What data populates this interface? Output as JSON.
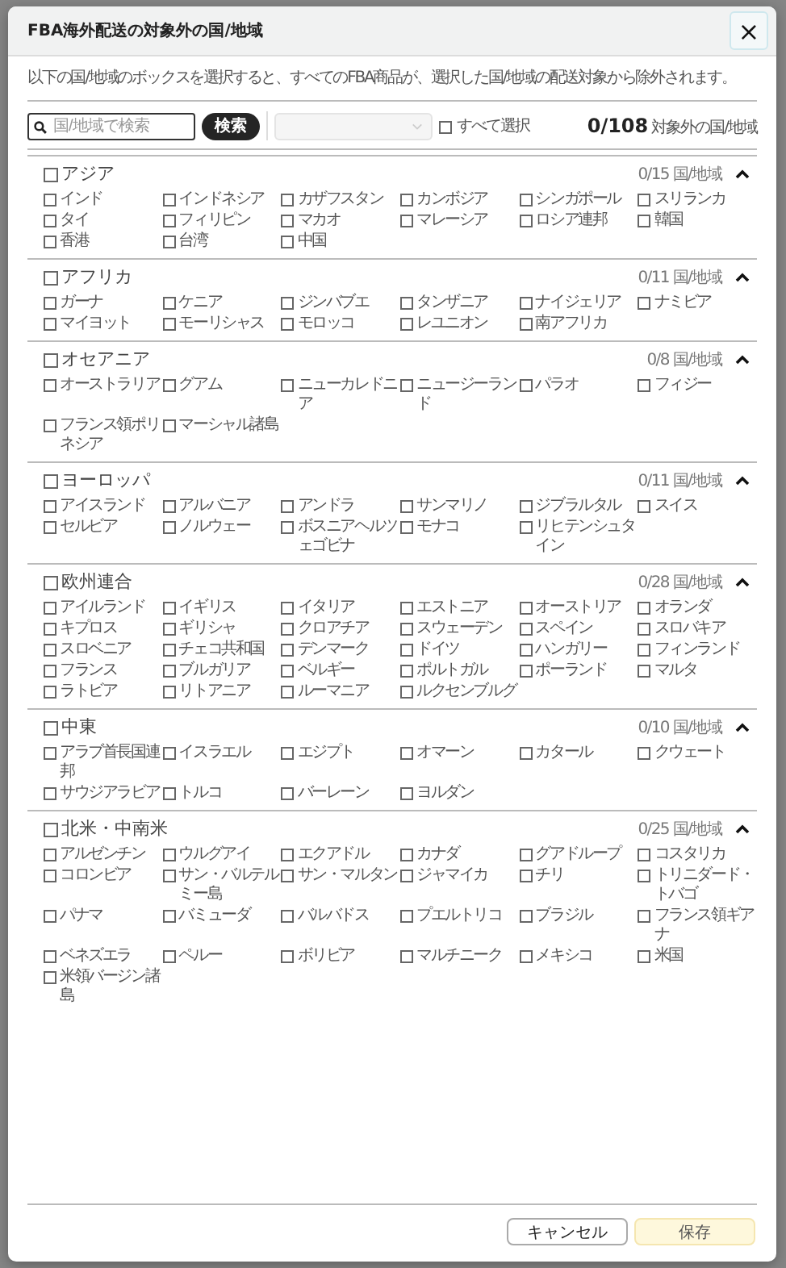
{
  "dialog": {
    "title": "FBA海外配送の対象外の国/地域",
    "close": "×",
    "description": "以下の国/地域のボックスを選択すると、すべてのFBA商品が、選択した国/地域の配送対象から除外されます。"
  },
  "toolbar": {
    "search": {
      "placeholder": "国/地域で検索"
    },
    "search_button": "検索",
    "dropdown": {
      "disabled": true
    },
    "select_all": {
      "label": "すべて選択",
      "checked": false
    },
    "count": "0/108",
    "count_label": "対象外の国/地域"
  },
  "regions": [
    {
      "name": "アジア",
      "checked": false,
      "count": "0/15 国/地域",
      "expanded": true,
      "countries": [
        {
          "name": "インド",
          "checked": false
        },
        {
          "name": "インドネシア",
          "checked": false
        },
        {
          "name": "カザフスタン",
          "checked": false
        },
        {
          "name": "カンボジア",
          "checked": false
        },
        {
          "name": "シンガポール",
          "checked": false
        },
        {
          "name": "スリランカ",
          "checked": false
        },
        {
          "name": "タイ",
          "checked": false
        },
        {
          "name": "フィリピン",
          "checked": false
        },
        {
          "name": "マカオ",
          "checked": false
        },
        {
          "name": "マレーシア",
          "checked": false
        },
        {
          "name": "ロシア連邦",
          "checked": false
        },
        {
          "name": "韓国",
          "checked": false
        },
        {
          "name": "香港",
          "checked": false
        },
        {
          "name": "台湾",
          "checked": false
        },
        {
          "name": "中国",
          "checked": false
        }
      ]
    },
    {
      "name": "アフリカ",
      "checked": false,
      "count": "0/11 国/地域",
      "expanded": true,
      "countries": [
        {
          "name": "ガーナ",
          "checked": false
        },
        {
          "name": "ケニア",
          "checked": false
        },
        {
          "name": "ジンバブエ",
          "checked": false
        },
        {
          "name": "タンザニア",
          "checked": false
        },
        {
          "name": "ナイジェリア",
          "checked": false
        },
        {
          "name": "ナミビア",
          "checked": false
        },
        {
          "name": "マイヨット",
          "checked": false
        },
        {
          "name": "モーリシャス",
          "checked": false
        },
        {
          "name": "モロッコ",
          "checked": false
        },
        {
          "name": "レユニオン",
          "checked": false
        },
        {
          "name": "南アフリカ",
          "checked": false
        }
      ]
    },
    {
      "name": "オセアニア",
      "checked": false,
      "count": "0/8 国/地域",
      "expanded": true,
      "countries": [
        {
          "name": "オーストラリア",
          "checked": false
        },
        {
          "name": "グアム",
          "checked": false
        },
        {
          "name": "ニューカレドニア",
          "checked": false
        },
        {
          "name": "ニュージーランド",
          "checked": false
        },
        {
          "name": "パラオ",
          "checked": false
        },
        {
          "name": "フィジー",
          "checked": false
        },
        {
          "name": "フランス領ポリネシア",
          "checked": false
        },
        {
          "name": "マーシャル諸島",
          "checked": false
        }
      ]
    },
    {
      "name": "ヨーロッパ",
      "checked": false,
      "count": "0/11 国/地域",
      "expanded": true,
      "countries": [
        {
          "name": "アイスランド",
          "checked": false
        },
        {
          "name": "アルバニア",
          "checked": false
        },
        {
          "name": "アンドラ",
          "checked": false
        },
        {
          "name": "サンマリノ",
          "checked": false
        },
        {
          "name": "ジブラルタル",
          "checked": false
        },
        {
          "name": "スイス",
          "checked": false
        },
        {
          "name": "セルビア",
          "checked": false
        },
        {
          "name": "ノルウェー",
          "checked": false
        },
        {
          "name": "ボスニアヘルツェゴビナ",
          "checked": false
        },
        {
          "name": "モナコ",
          "checked": false
        },
        {
          "name": "リヒテンシュタイン",
          "checked": false
        }
      ]
    },
    {
      "name": "欧州連合",
      "checked": false,
      "count": "0/28 国/地域",
      "expanded": true,
      "countries": [
        {
          "name": "アイルランド",
          "checked": false
        },
        {
          "name": "イギリス",
          "checked": false
        },
        {
          "name": "イタリア",
          "checked": false
        },
        {
          "name": "エストニア",
          "checked": false
        },
        {
          "name": "オーストリア",
          "checked": false
        },
        {
          "name": "オランダ",
          "checked": false
        },
        {
          "name": "キプロス",
          "checked": false
        },
        {
          "name": "ギリシャ",
          "checked": false
        },
        {
          "name": "クロアチア",
          "checked": false
        },
        {
          "name": "スウェーデン",
          "checked": false
        },
        {
          "name": "スペイン",
          "checked": false
        },
        {
          "name": "スロバキア",
          "checked": false
        },
        {
          "name": "スロベニア",
          "checked": false
        },
        {
          "name": "チェコ共和国",
          "checked": false
        },
        {
          "name": "デンマーク",
          "checked": false
        },
        {
          "name": "ドイツ",
          "checked": false
        },
        {
          "name": "ハンガリー",
          "checked": false
        },
        {
          "name": "フィンランド",
          "checked": false
        },
        {
          "name": "フランス",
          "checked": false
        },
        {
          "name": "ブルガリア",
          "checked": false
        },
        {
          "name": "ベルギー",
          "checked": false
        },
        {
          "name": "ポルトガル",
          "checked": false
        },
        {
          "name": "ポーランド",
          "checked": false
        },
        {
          "name": "マルタ",
          "checked": false
        },
        {
          "name": "ラトビア",
          "checked": false
        },
        {
          "name": "リトアニア",
          "checked": false
        },
        {
          "name": "ルーマニア",
          "checked": false
        },
        {
          "name": "ルクセンブルグ",
          "checked": false
        }
      ]
    },
    {
      "name": "中東",
      "checked": false,
      "count": "0/10 国/地域",
      "expanded": true,
      "countries": [
        {
          "name": "アラブ首長国連邦",
          "checked": false
        },
        {
          "name": "イスラエル",
          "checked": false
        },
        {
          "name": "エジプト",
          "checked": false
        },
        {
          "name": "オマーン",
          "checked": false
        },
        {
          "name": "カタール",
          "checked": false
        },
        {
          "name": "クウェート",
          "checked": false
        },
        {
          "name": "サウジアラビア",
          "checked": false
        },
        {
          "name": "トルコ",
          "checked": false
        },
        {
          "name": "バーレーン",
          "checked": false
        },
        {
          "name": "ヨルダン",
          "checked": false
        }
      ]
    },
    {
      "name": "北米・中南米",
      "checked": false,
      "count": "0/25 国/地域",
      "expanded": true,
      "countries": [
        {
          "name": "アルゼンチン",
          "checked": false
        },
        {
          "name": "ウルグアイ",
          "checked": false
        },
        {
          "name": "エクアドル",
          "checked": false
        },
        {
          "name": "カナダ",
          "checked": false
        },
        {
          "name": "グアドループ",
          "checked": false
        },
        {
          "name": "コスタリカ",
          "checked": false
        },
        {
          "name": "コロンビア",
          "checked": false
        },
        {
          "name": "サン・バルテルミー島",
          "checked": false
        },
        {
          "name": "サン・マルタン",
          "checked": false
        },
        {
          "name": "ジャマイカ",
          "checked": false
        },
        {
          "name": "チリ",
          "checked": false
        },
        {
          "name": "トリニダード・トバゴ",
          "checked": false
        },
        {
          "name": "パナマ",
          "checked": false
        },
        {
          "name": "バミューダ",
          "checked": false
        },
        {
          "name": "バルバドス",
          "checked": false
        },
        {
          "name": "プエルトリコ",
          "checked": false
        },
        {
          "name": "ブラジル",
          "checked": false
        },
        {
          "name": "フランス領ギアナ",
          "checked": false
        },
        {
          "name": "ベネズエラ",
          "checked": false
        },
        {
          "name": "ペルー",
          "checked": false
        },
        {
          "name": "ボリビア",
          "checked": false
        },
        {
          "name": "マルチニーク",
          "checked": false
        },
        {
          "name": "メキシコ",
          "checked": false
        },
        {
          "name": "米国",
          "checked": false
        },
        {
          "name": "米領バージン諸島",
          "checked": false
        }
      ]
    }
  ],
  "footer": {
    "cancel": "キャンセル",
    "save": "保存"
  }
}
